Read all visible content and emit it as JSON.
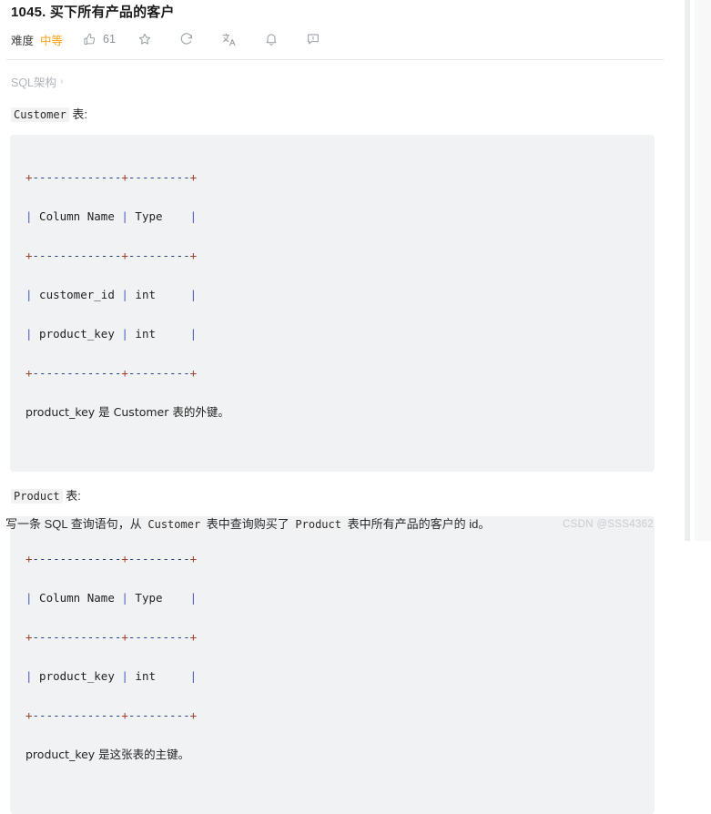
{
  "header": {
    "title": "1045. 买下所有产品的客户",
    "difficulty_label": "难度",
    "difficulty_value": "中等",
    "difficulty_color": "#ffa116",
    "like_count": "61",
    "icons": {
      "thumbs_up": "thumbs-up-icon",
      "star": "star-icon",
      "share": "share-icon",
      "translate": "translate-icon",
      "bell": "bell-icon",
      "comment": "comment-icon"
    }
  },
  "breadcrumb": {
    "label": "SQL架构",
    "chevron": "›"
  },
  "sections": [
    {
      "heading_code": "Customer",
      "heading_suffix": " 表:",
      "code_lines": [
        "+-------------+---------+",
        "| Column Name | Type    |",
        "+-------------+---------+",
        "| customer_id | int     |",
        "| product_key | int     |",
        "+-------------+---------+"
      ],
      "note": "product_key 是 Customer 表的外键。"
    },
    {
      "heading_code": "Product",
      "heading_suffix": " 表:",
      "code_lines": [
        "+-------------+---------+",
        "| Column Name | Type    |",
        "+-------------+---------+",
        "| product_key | int     |",
        "+-------------+---------+"
      ],
      "note": "product_key 是这张表的主键。"
    }
  ],
  "question": {
    "part1": "写一条 SQL 查询语句，从 ",
    "code1": "Customer",
    "part2": " 表中查询购买了 ",
    "code2": "Product",
    "part3": " 表中所有产品的客户的 id。"
  },
  "watermark": {
    "text": "CSDN @SSS4362"
  }
}
